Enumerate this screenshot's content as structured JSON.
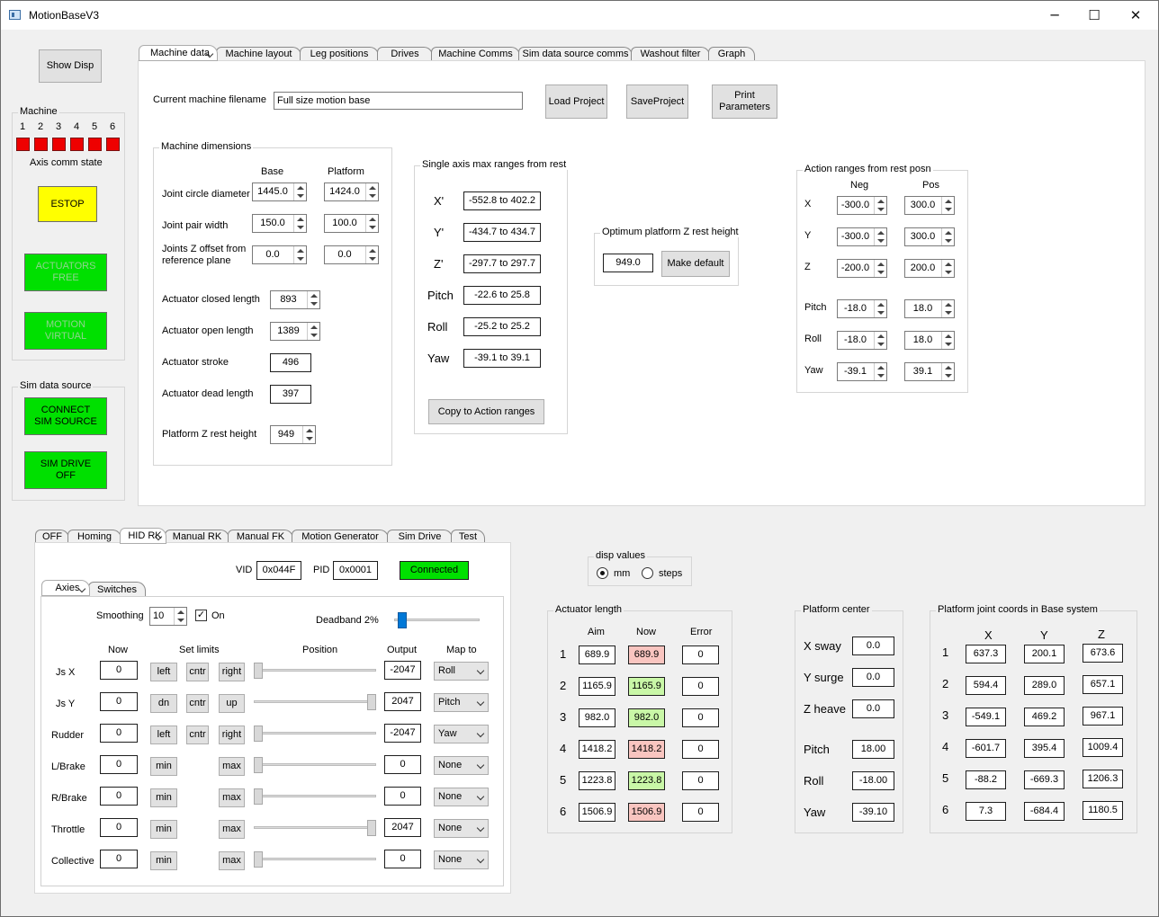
{
  "window": {
    "title": "MotionBaseV3",
    "min": "─",
    "max": "☐",
    "close": "✕"
  },
  "left": {
    "show_disp": "Show Disp",
    "machine_group": "Machine",
    "axis_nums": [
      "1",
      "2",
      "3",
      "4",
      "5",
      "6"
    ],
    "axis_state": "Axis comm state",
    "estop": "ESTOP",
    "act_free": "ACTUATORS\nFREE",
    "motion_virtual": "MOTION\nVIRTUAL",
    "sim_group": "Sim data source",
    "connect": "CONNECT\nSIM SOURCE",
    "sim_drive": "SIM DRIVE\nOFF"
  },
  "top_tabs": [
    "Machine data",
    "Machine layout",
    "Leg positions",
    "Drives",
    "Machine Comms",
    "Sim data source comms",
    "Washout filter",
    "Graph"
  ],
  "machine": {
    "filename_label": "Current machine filename",
    "filename": "Full size motion base",
    "load": "Load Project",
    "save": "SaveProject",
    "print": "Print\nParameters",
    "dims_group": "Machine dimensions",
    "col_base": "Base",
    "col_platform": "Platform",
    "jcd_label": "Joint circle diameter",
    "jcd_base": "1445.0",
    "jcd_plat": "1424.0",
    "jpw_label": "Joint pair width",
    "jpw_base": "150.0",
    "jpw_plat": "100.0",
    "jzo_label": "Joints Z offset from\nreference plane",
    "jzo_base": "0.0",
    "jzo_plat": "0.0",
    "acl_label": "Actuator closed length",
    "acl": "893",
    "aol_label": "Actuator open length",
    "aol": "1389",
    "as_label": "Actuator stroke",
    "as": "496",
    "adl_label": "Actuator dead length",
    "adl": "397",
    "pzr_label": "Platform Z rest height",
    "pzr": "949",
    "single_group": "Single axis max ranges from rest",
    "single": [
      {
        "label": "X'",
        "value": "-552.8 to 402.2"
      },
      {
        "label": "Y'",
        "value": "-434.7 to 434.7"
      },
      {
        "label": "Z'",
        "value": "-297.7 to 297.7"
      },
      {
        "label": "Pitch",
        "value": "-22.6 to 25.8"
      },
      {
        "label": "Roll",
        "value": "-25.2 to 25.2"
      },
      {
        "label": "Yaw",
        "value": "-39.1 to 39.1"
      }
    ],
    "copy": "Copy to Action ranges",
    "opt_group": "Optimum platform Z rest height",
    "opt_value": "949.0",
    "make_default": "Make default",
    "action_group": "Action ranges from rest posn",
    "neg": "Neg",
    "pos": "Pos",
    "action": [
      {
        "label": "X",
        "neg": "-300.0",
        "pos": "300.0"
      },
      {
        "label": "Y",
        "neg": "-300.0",
        "pos": "300.0"
      },
      {
        "label": "Z",
        "neg": "-200.0",
        "pos": "200.0"
      },
      {
        "label": "Pitch",
        "neg": "-18.0",
        "pos": "18.0"
      },
      {
        "label": "Roll",
        "neg": "-18.0",
        "pos": "18.0"
      },
      {
        "label": "Yaw",
        "neg": "-39.1",
        "pos": "39.1"
      }
    ]
  },
  "bottom_tabs": [
    "OFF",
    "Homing",
    "HID RK",
    "Manual RK",
    "Manual FK",
    "Motion Generator",
    "Sim Drive",
    "Test"
  ],
  "hid": {
    "vid_label": "VID",
    "vid": "0x044F",
    "pid_label": "PID",
    "pid": "0x0001",
    "connected": "Connected",
    "sub_tabs": [
      "Axies",
      "Switches"
    ],
    "smoothing_label": "Smoothing",
    "smoothing": "10",
    "on": "On",
    "deadband": "Deadband 2%",
    "deadband_level": 0.02,
    "h_now": "Now",
    "h_limits": "Set limits",
    "h_position": "Position",
    "h_output": "Output",
    "h_map": "Map to",
    "axes": [
      {
        "label": "Js X",
        "now": "0",
        "b1": "left",
        "b2": "cntr",
        "b3": "right",
        "pos": 0.0,
        "output": "-2047",
        "map": "Roll"
      },
      {
        "label": "Js Y",
        "now": "0",
        "b1": "dn",
        "b2": "cntr",
        "b3": "up",
        "pos": 1.0,
        "output": "2047",
        "map": "Pitch"
      },
      {
        "label": "Rudder",
        "now": "0",
        "b1": "left",
        "b2": "cntr",
        "b3": "right",
        "pos": 0.0,
        "output": "-2047",
        "map": "Yaw"
      },
      {
        "label": "L/Brake",
        "now": "0",
        "b1": "min",
        "b2": "",
        "b3": "max",
        "pos": 0.0,
        "output": "0",
        "map": "None"
      },
      {
        "label": "R/Brake",
        "now": "0",
        "b1": "min",
        "b2": "",
        "b3": "max",
        "pos": 0.0,
        "output": "0",
        "map": "None"
      },
      {
        "label": "Throttle",
        "now": "0",
        "b1": "min",
        "b2": "",
        "b3": "max",
        "pos": 1.0,
        "output": "2047",
        "map": "None"
      },
      {
        "label": "Collective",
        "now": "0",
        "b1": "min",
        "b2": "",
        "b3": "max",
        "pos": 0.0,
        "output": "0",
        "map": "None"
      }
    ]
  },
  "disp": {
    "group": "disp values",
    "mm": "mm",
    "steps": "steps"
  },
  "actuator": {
    "group": "Actuator length",
    "aim": "Aim",
    "now": "Now",
    "error": "Error",
    "rows": [
      {
        "n": "1",
        "aim": "689.9",
        "now": "689.9",
        "err": "0",
        "state": "red"
      },
      {
        "n": "2",
        "aim": "1165.9",
        "now": "1165.9",
        "err": "0",
        "state": "grn"
      },
      {
        "n": "3",
        "aim": "982.0",
        "now": "982.0",
        "err": "0",
        "state": "grn"
      },
      {
        "n": "4",
        "aim": "1418.2",
        "now": "1418.2",
        "err": "0",
        "state": "red"
      },
      {
        "n": "5",
        "aim": "1223.8",
        "now": "1223.8",
        "err": "0",
        "state": "grn"
      },
      {
        "n": "6",
        "aim": "1506.9",
        "now": "1506.9",
        "err": "0",
        "state": "red"
      }
    ],
    "colors": {
      "red": "#f9c5c0",
      "grn": "#c9f7a7"
    }
  },
  "center": {
    "group": "Platform center",
    "rows": [
      {
        "label": "X sway",
        "value": "0.0"
      },
      {
        "label": "Y surge",
        "value": "0.0"
      },
      {
        "label": "Z heave",
        "value": "0.0"
      },
      {
        "label": "Pitch",
        "value": "18.00"
      },
      {
        "label": "Roll",
        "value": "-18.00"
      },
      {
        "label": "Yaw",
        "value": "-39.10"
      }
    ]
  },
  "joints": {
    "group": "Platform joint coords in Base system",
    "x": "X",
    "y": "Y",
    "z": "Z",
    "rows": [
      {
        "n": "1",
        "x": "637.3",
        "y": "200.1",
        "z": "673.6"
      },
      {
        "n": "2",
        "x": "594.4",
        "y": "289.0",
        "z": "657.1"
      },
      {
        "n": "3",
        "x": "-549.1",
        "y": "469.2",
        "z": "967.1"
      },
      {
        "n": "4",
        "x": "-601.7",
        "y": "395.4",
        "z": "1009.4"
      },
      {
        "n": "5",
        "x": "-88.2",
        "y": "-669.3",
        "z": "1206.3"
      },
      {
        "n": "6",
        "x": "7.3",
        "y": "-684.4",
        "z": "1180.5"
      }
    ]
  },
  "colors": {
    "green": "#00e000",
    "yellow": "#ffff00",
    "led": "#ee0000",
    "slider": "#0078d7"
  }
}
